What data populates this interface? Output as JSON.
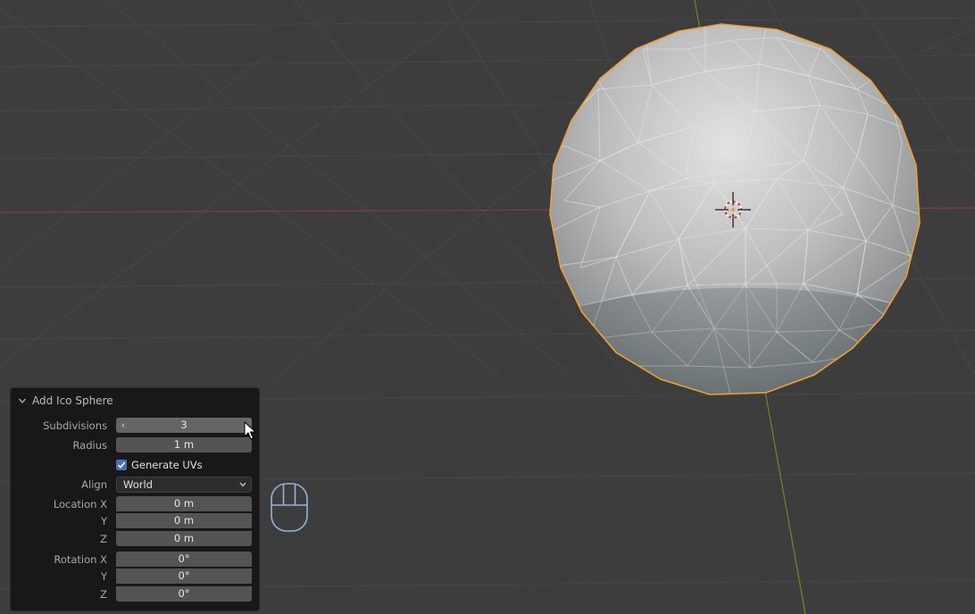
{
  "viewport": {
    "background": "#3d3d3d",
    "grid_color": "#474747",
    "x_axis_color": "#8a3b3b",
    "y_axis_color": "#6b8a2a",
    "selection_outline_color": "#f0a030",
    "object": "ico-sphere"
  },
  "operator_panel": {
    "title": "Add Ico Sphere",
    "subdivisions": {
      "label": "Subdivisions",
      "value": "3"
    },
    "radius": {
      "label": "Radius",
      "value": "1 m"
    },
    "generate_uvs": {
      "label": "Generate UVs",
      "checked": true
    },
    "align": {
      "label": "Align",
      "value": "World"
    },
    "location": {
      "x": {
        "label": "Location X",
        "value": "0 m"
      },
      "y": {
        "label": "Y",
        "value": "0 m"
      },
      "z": {
        "label": "Z",
        "value": "0 m"
      }
    },
    "rotation": {
      "x": {
        "label": "Rotation X",
        "value": "0°"
      },
      "y": {
        "label": "Y",
        "value": "0°"
      },
      "z": {
        "label": "Z",
        "value": "0°"
      }
    }
  },
  "status_hint": {
    "icon": "mouse-icon"
  },
  "accent_color": "#4772b3"
}
